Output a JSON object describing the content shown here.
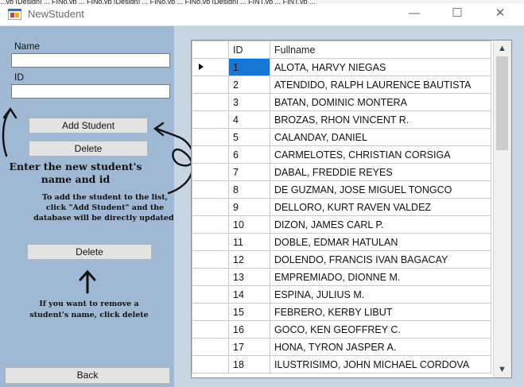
{
  "top_strip": "...vb [Design] ... FINo.vb ... FINo.vb [Design] ... FINo.vb ... FINo.vb [Design] ... FINT.vb ... FINT.vb ...",
  "window": {
    "title": "NewStudent",
    "minimize": "—",
    "maximize": "☐",
    "close": "✕"
  },
  "form": {
    "name_label": "Name",
    "name_value": "",
    "id_label": "ID",
    "id_value": "",
    "add_button": "Add Student",
    "delete_button_top": "Delete",
    "delete_button_middle": "Delete",
    "back_button": "Back"
  },
  "annotations": {
    "note1_line1": "Enter the new student's",
    "note1_line2": "name and id",
    "note2_line1": "To add the student to the list,",
    "note2_line2": "click \"Add Student\" and the",
    "note2_line3": "database will be directly updated.",
    "note3_line1": "If you want to remove a",
    "note3_line2": "student's name, click delete"
  },
  "grid": {
    "columns": [
      "ID",
      "Fullname"
    ],
    "selected_index": 0,
    "rows": [
      {
        "id": "1",
        "name": "ALOTA, HARVY NIEGAS"
      },
      {
        "id": "2",
        "name": "ATENDIDO, RALPH LAURENCE BAUTISTA"
      },
      {
        "id": "3",
        "name": "BATAN, DOMINIC MONTERA"
      },
      {
        "id": "4",
        "name": "BROZAS, RHON VINCENT R."
      },
      {
        "id": "5",
        "name": "CALANDAY, DANIEL"
      },
      {
        "id": "6",
        "name": "CARMELOTES, CHRISTIAN CORSIGA"
      },
      {
        "id": "7",
        "name": "DABAL, FREDDIE REYES"
      },
      {
        "id": "8",
        "name": "DE GUZMAN, JOSE MIGUEL TONGCO"
      },
      {
        "id": "9",
        "name": "DELLORO, KURT RAVEN VALDEZ"
      },
      {
        "id": "10",
        "name": "DIZON, JAMES CARL P."
      },
      {
        "id": "11",
        "name": "DOBLE, EDMAR HATULAN"
      },
      {
        "id": "12",
        "name": "DOLENDO, FRANCIS IVAN  BAGACAY"
      },
      {
        "id": "13",
        "name": "EMPREMIADO, DIONNE M."
      },
      {
        "id": "14",
        "name": "ESPINA, JULIUS M."
      },
      {
        "id": "15",
        "name": "FEBRERO, KERBY LIBUT"
      },
      {
        "id": "16",
        "name": "GOCO, KEN GEOFFREY C."
      },
      {
        "id": "17",
        "name": "HONA, TYRON JASPER A."
      },
      {
        "id": "18",
        "name": "ILUSTRISIMO, JOHN MICHAEL CORDOVA"
      }
    ]
  },
  "colors": {
    "left_panel": "#9fb8d3",
    "right_panel": "#c7d5e2",
    "selection": "#1677d6"
  }
}
